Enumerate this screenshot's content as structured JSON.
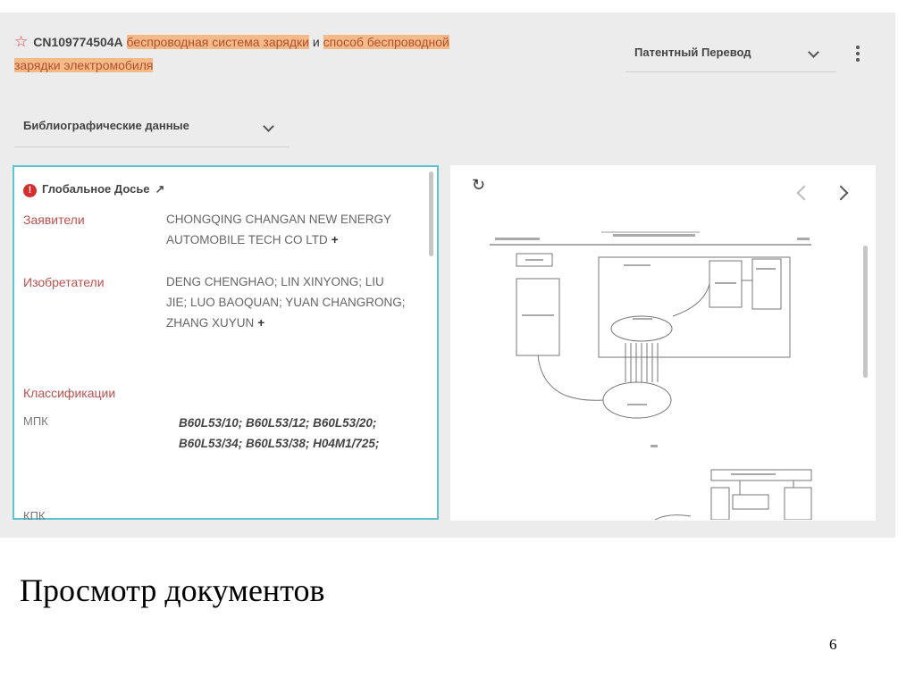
{
  "document": {
    "star_icon": "star-icon",
    "number": "CN109774504A",
    "title_parts": [
      "беспроводная система зарядки",
      "и",
      "способ беспроводной",
      "зарядки электромобиля"
    ]
  },
  "translation_dropdown": {
    "label": "Патентный Перевод"
  },
  "section_dropdown": {
    "label": "Библиографические данные"
  },
  "left_panel": {
    "global_dossier": "Глобальное Досье",
    "applicants_label": "Заявители",
    "applicants_value": "CHONGQING CHANGAN NEW ENERGY AUTOMOBILE TECH CO LTD",
    "inventors_label": "Изобретатели",
    "inventors_value": "DENG CHENGHAO; LIN XINYONG; LIU JIE; LUO BAOQUAN; YUAN CHANGRONG; ZHANG XUYUN",
    "classifications_label": "Классификации",
    "ipc_label": "МПК",
    "ipc_value": "B60L53/10; B60L53/12; B60L53/20; B60L53/34; B60L53/38; H04M1/725;",
    "cpc_label": "КПК",
    "plus": "+"
  },
  "slide": {
    "heading": "Просмотр документов",
    "page_number": "6"
  }
}
